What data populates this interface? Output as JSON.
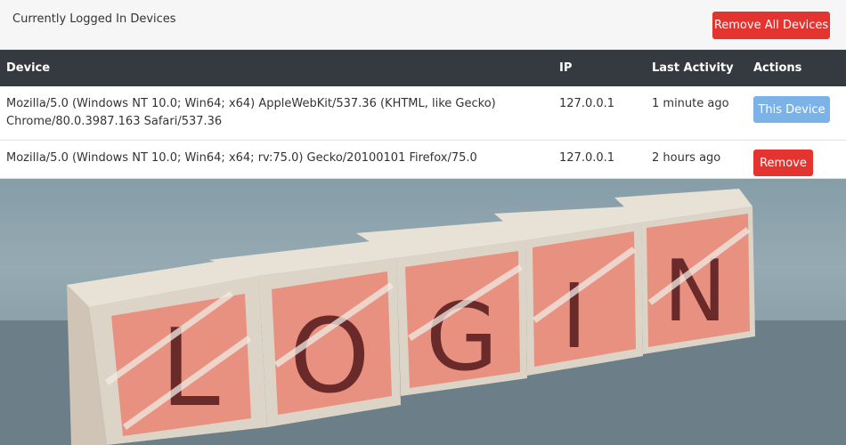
{
  "header": {
    "title": "Currently Logged In Devices",
    "remove_all_label": "Remove All Devices"
  },
  "table": {
    "columns": [
      "Device",
      "IP",
      "Last Activity",
      "Actions"
    ],
    "rows": [
      {
        "device": "Mozilla/5.0 (Windows NT 10.0; Win64; x64) AppleWebKit/537.36 (KHTML, like Gecko) Chrome/80.0.3987.163 Safari/537.36",
        "ip": "127.0.0.1",
        "last_activity": "1 minute ago",
        "action": "This Device"
      },
      {
        "device": "Mozilla/5.0 (Windows NT 10.0; Win64; x64; rv:75.0) Gecko/20100101 Firefox/75.0",
        "ip": "127.0.0.1",
        "last_activity": "2 hours ago",
        "action": "Remove"
      }
    ]
  },
  "photo": {
    "letters": [
      "L",
      "O",
      "G",
      "I",
      "N"
    ]
  },
  "colors": {
    "danger": "#e3342f",
    "primary_light": "#7bb3e8",
    "table_header": "#343a40",
    "block_face": "#e98a78",
    "block_wood": "#ddd4c8"
  }
}
